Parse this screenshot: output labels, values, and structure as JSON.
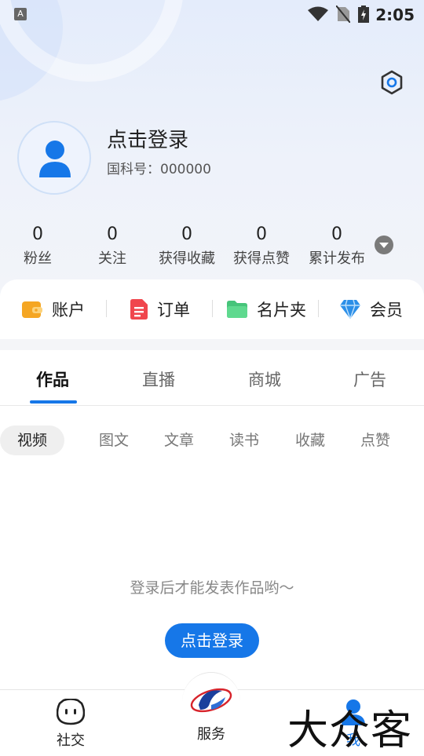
{
  "status_bar": {
    "indicator": "A",
    "time": "2:05"
  },
  "profile": {
    "title": "点击登录",
    "sci_id_label": "国科号：",
    "sci_id_value": "000000"
  },
  "stats": [
    {
      "value": "0",
      "label": "粉丝"
    },
    {
      "value": "0",
      "label": "关注"
    },
    {
      "value": "0",
      "label": "获得收藏"
    },
    {
      "value": "0",
      "label": "获得点赞"
    },
    {
      "value": "0",
      "label": "累计发布"
    }
  ],
  "quick_actions": [
    {
      "label": "账户",
      "icon": "wallet-icon"
    },
    {
      "label": "订单",
      "icon": "order-icon"
    },
    {
      "label": "名片夹",
      "icon": "folder-icon"
    },
    {
      "label": "会员",
      "icon": "diamond-icon"
    }
  ],
  "tabs": [
    "作品",
    "直播",
    "商城",
    "广告"
  ],
  "subtabs": [
    "视频",
    "图文",
    "文章",
    "读书",
    "收藏",
    "点赞"
  ],
  "empty_message": "登录后才能发表作品哟～",
  "cta": "点击登录",
  "bottom_nav": [
    {
      "label": "社交",
      "icon": "cat-face-icon"
    },
    {
      "label": "服务",
      "icon": "logo-icon"
    },
    {
      "label": "我",
      "icon": "person-icon"
    }
  ],
  "watermark": "大众客",
  "colors": {
    "accent": "#1677e8",
    "order_red": "#f0464d",
    "wallet_orange": "#f5a623",
    "folder_green": "#46c47a"
  }
}
